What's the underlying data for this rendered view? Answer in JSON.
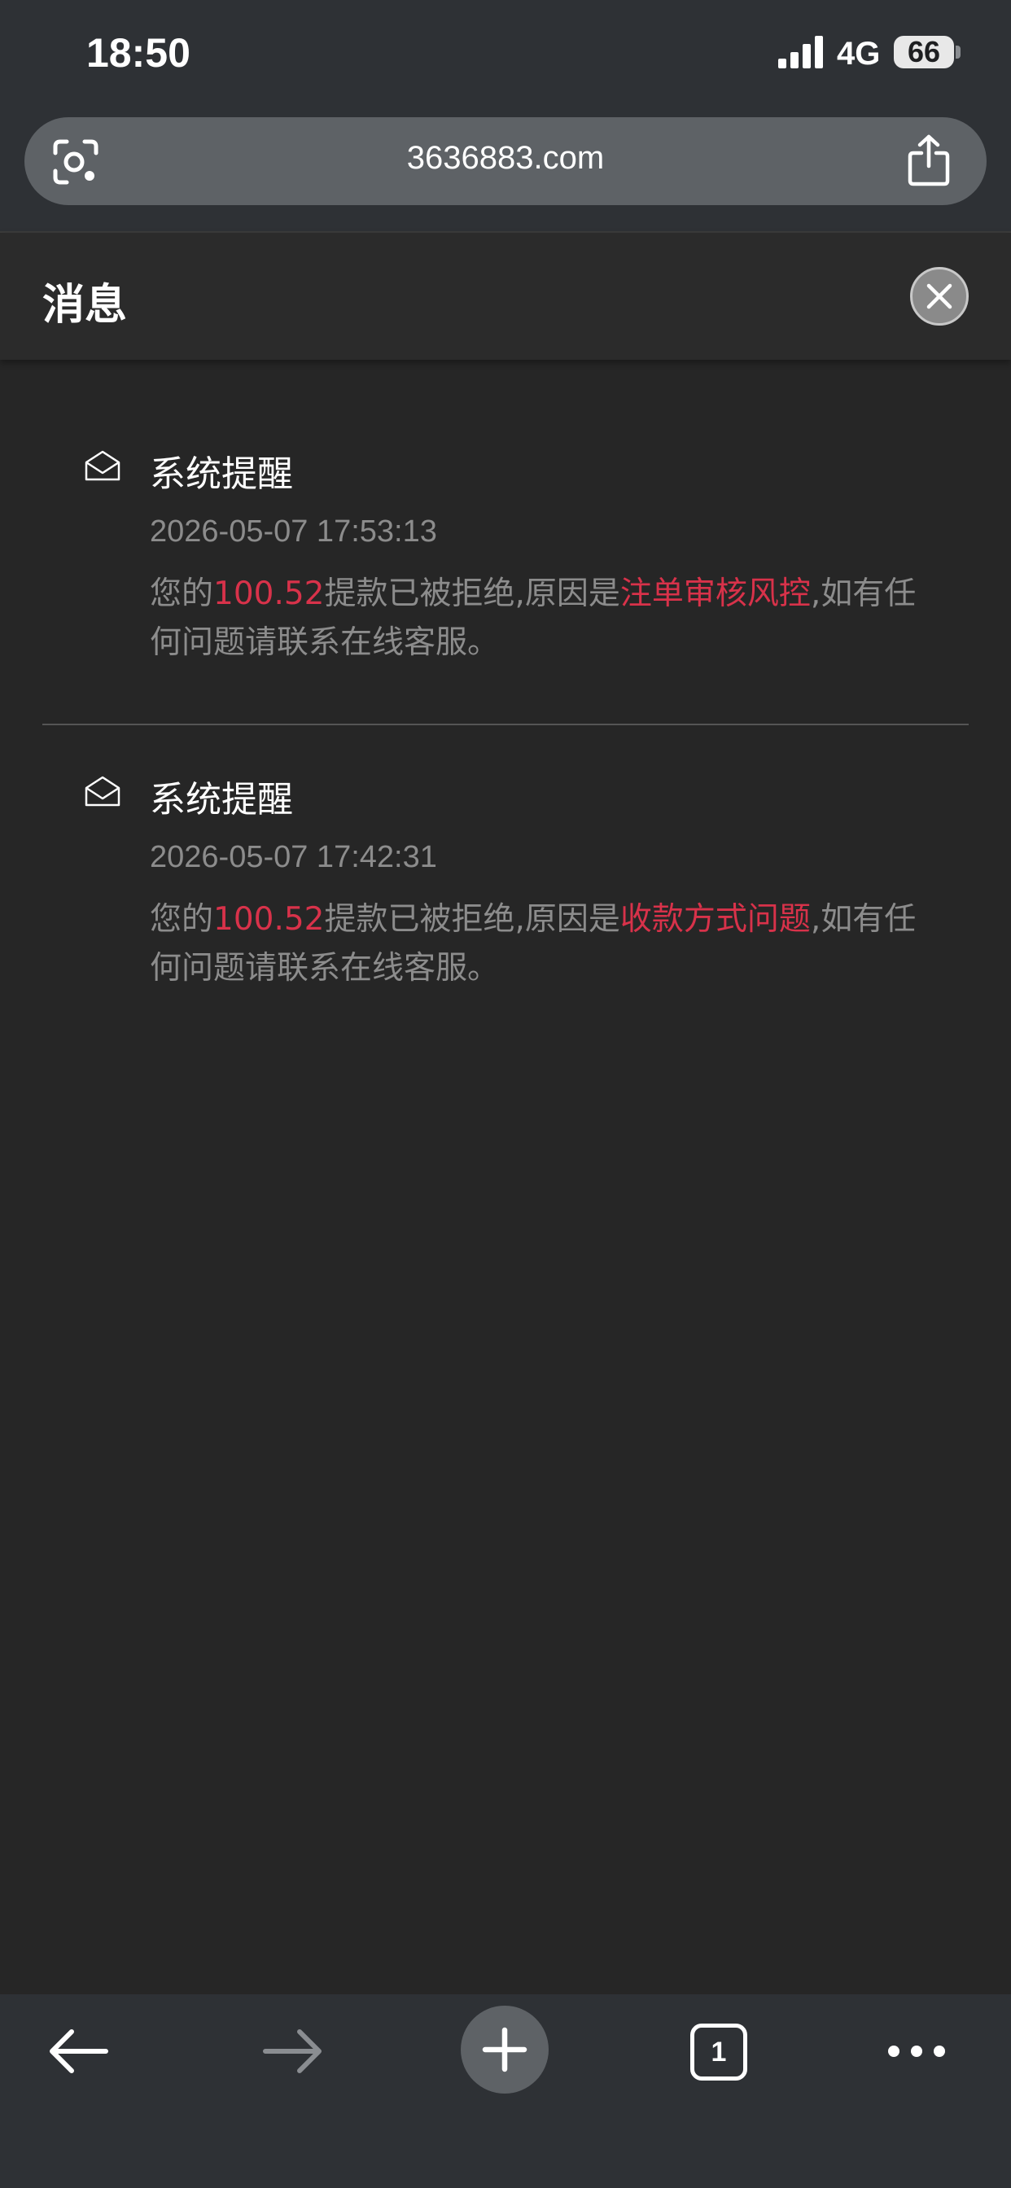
{
  "status_bar": {
    "time": "18:50",
    "network": "4G",
    "battery": "66"
  },
  "address_bar": {
    "url": "3636883.com"
  },
  "panel": {
    "title": "消息"
  },
  "messages": [
    {
      "title": "系统提醒",
      "time": "2026-05-07 17:53:13",
      "body_prefix": "您的",
      "amount": "100.52",
      "body_middle": "提款已被拒绝,原因是",
      "reason": "注单审核风控",
      "body_suffix": ",如有任何问题请联系在线客服。"
    },
    {
      "title": "系统提醒",
      "time": "2026-05-07 17:42:31",
      "body_prefix": "您的",
      "amount": "100.52",
      "body_middle": "提款已被拒绝,原因是",
      "reason": "收款方式问题",
      "body_suffix": ",如有任何问题请联系在线客服。"
    }
  ],
  "toolbar": {
    "tab_count": "1",
    "icons": [
      "back-arrow-icon",
      "forward-arrow-icon",
      "plus-icon",
      "tabs-icon",
      "more-icon"
    ]
  },
  "colors": {
    "highlight": "#d8324a",
    "panel_bg": "#262626",
    "chrome_bg": "#2e3135"
  }
}
